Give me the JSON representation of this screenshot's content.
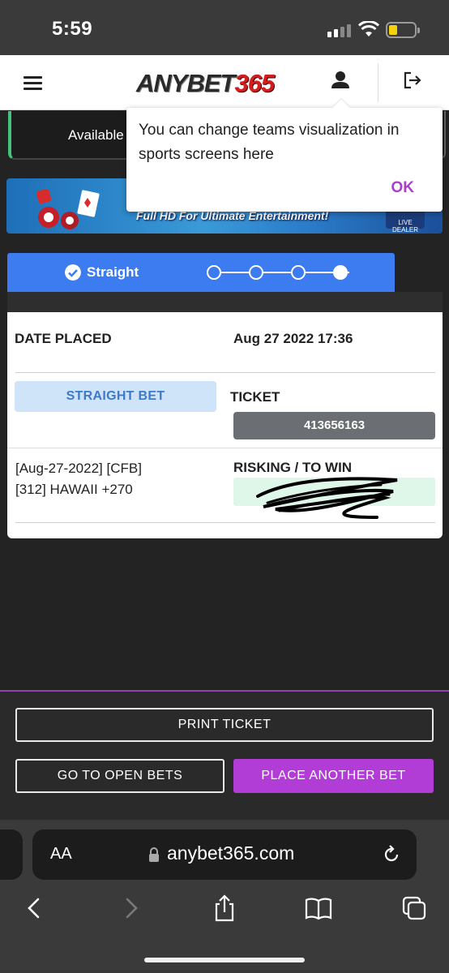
{
  "status_bar": {
    "time": "5:59"
  },
  "header": {
    "logo_part1": "ANYBET",
    "logo_part2": "365"
  },
  "available": {
    "label": "Available"
  },
  "tooltip": {
    "message": "You can change teams visualization in sports screens here",
    "ok_label": "OK"
  },
  "banner": {
    "text": "Full HD For Ultimate Entertainment!",
    "badge": "LIVE DEALER"
  },
  "wager_type": {
    "label": "Straight"
  },
  "receipt": {
    "date_label": "DATE PLACED",
    "date_value": "Aug 27 2022 17:36",
    "bet_type": "STRAIGHT BET",
    "ticket_label": "TICKET",
    "ticket_number": "413656163",
    "event_line1": "[Aug-27-2022] [CFB]",
    "event_line2": "[312] HAWAII +270",
    "risk_label": "RISKING / TO WIN"
  },
  "actions": {
    "print": "PRINT TICKET",
    "open_bets": "GO TO OPEN BETS",
    "place_another": "PLACE ANOTHER BET"
  },
  "browser": {
    "aa": "AA",
    "url": "anybet365.com"
  },
  "colors": {
    "primary_blue": "#3c7cf0",
    "accent_purple": "#b23dd6",
    "ok_purple": "#a742c8",
    "ticket_gray": "#6b6e73",
    "risk_green": "#dff7e8"
  }
}
